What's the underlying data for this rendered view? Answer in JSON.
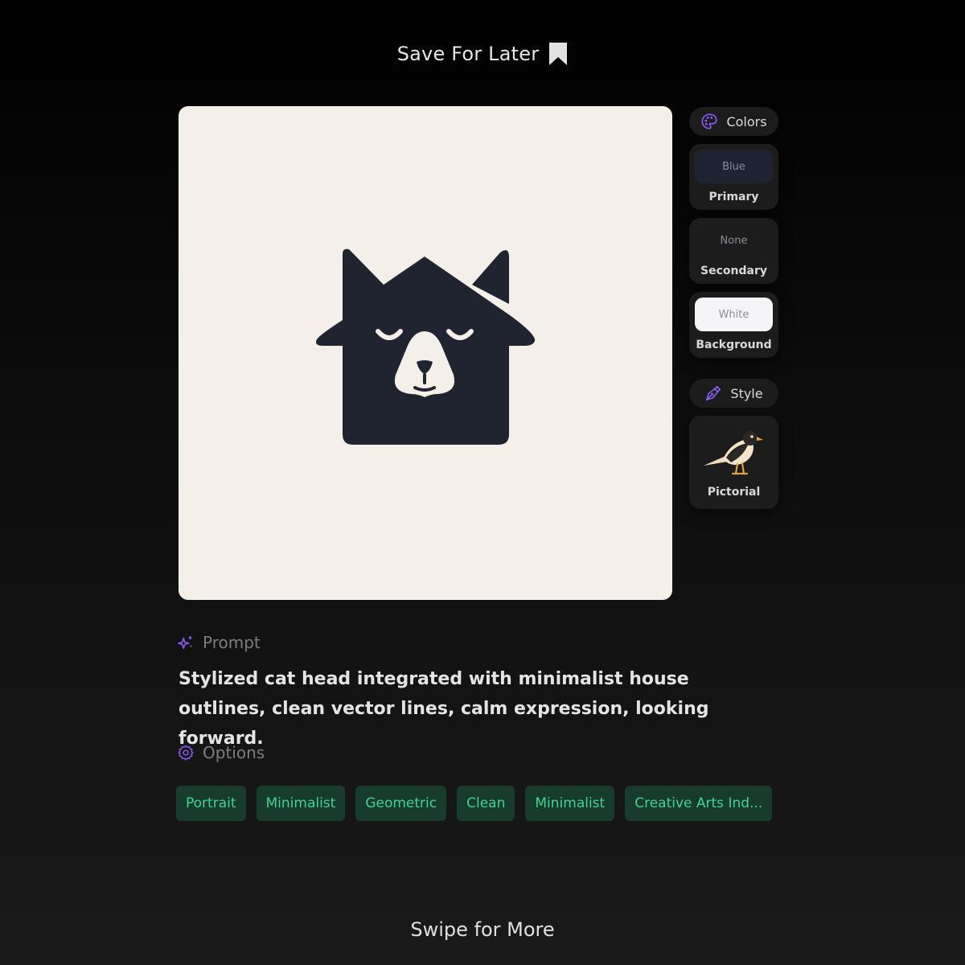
{
  "header": {
    "save_label": "Save For Later",
    "icon": "bookmark-icon"
  },
  "preview": {
    "alt": "Cat house logo",
    "background": "#f4efe8",
    "logo_color": "#1f2430"
  },
  "colors": {
    "title": "Colors",
    "icon": "palette-icon",
    "items": [
      {
        "value": "Blue",
        "role": "Primary",
        "swatch": "#1f2433"
      },
      {
        "value": "None",
        "role": "Secondary",
        "swatch": "#1c1c1c"
      },
      {
        "value": "White",
        "role": "Background",
        "swatch": "#f5f5f7"
      }
    ]
  },
  "style": {
    "title": "Style",
    "icon": "pen-nib-icon",
    "value": "Pictorial",
    "thumbnail_icon": "bird-icon"
  },
  "prompt": {
    "title": "Prompt",
    "icon": "sparkles-icon",
    "text": "Stylized cat head integrated with minimalist house outlines, clean vector lines, calm expression, looking forward."
  },
  "options": {
    "title": "Options",
    "icon": "gear-icon",
    "tags": [
      "Portrait",
      "Minimalist",
      "Geometric",
      "Clean",
      "Minimalist",
      "Creative Arts Ind..."
    ]
  },
  "footer": {
    "swipe_label": "Swipe for More"
  },
  "theme": {
    "accent_purple": "#8b5cf6",
    "tag_bg": "#173b2d",
    "tag_text": "#41d392"
  }
}
